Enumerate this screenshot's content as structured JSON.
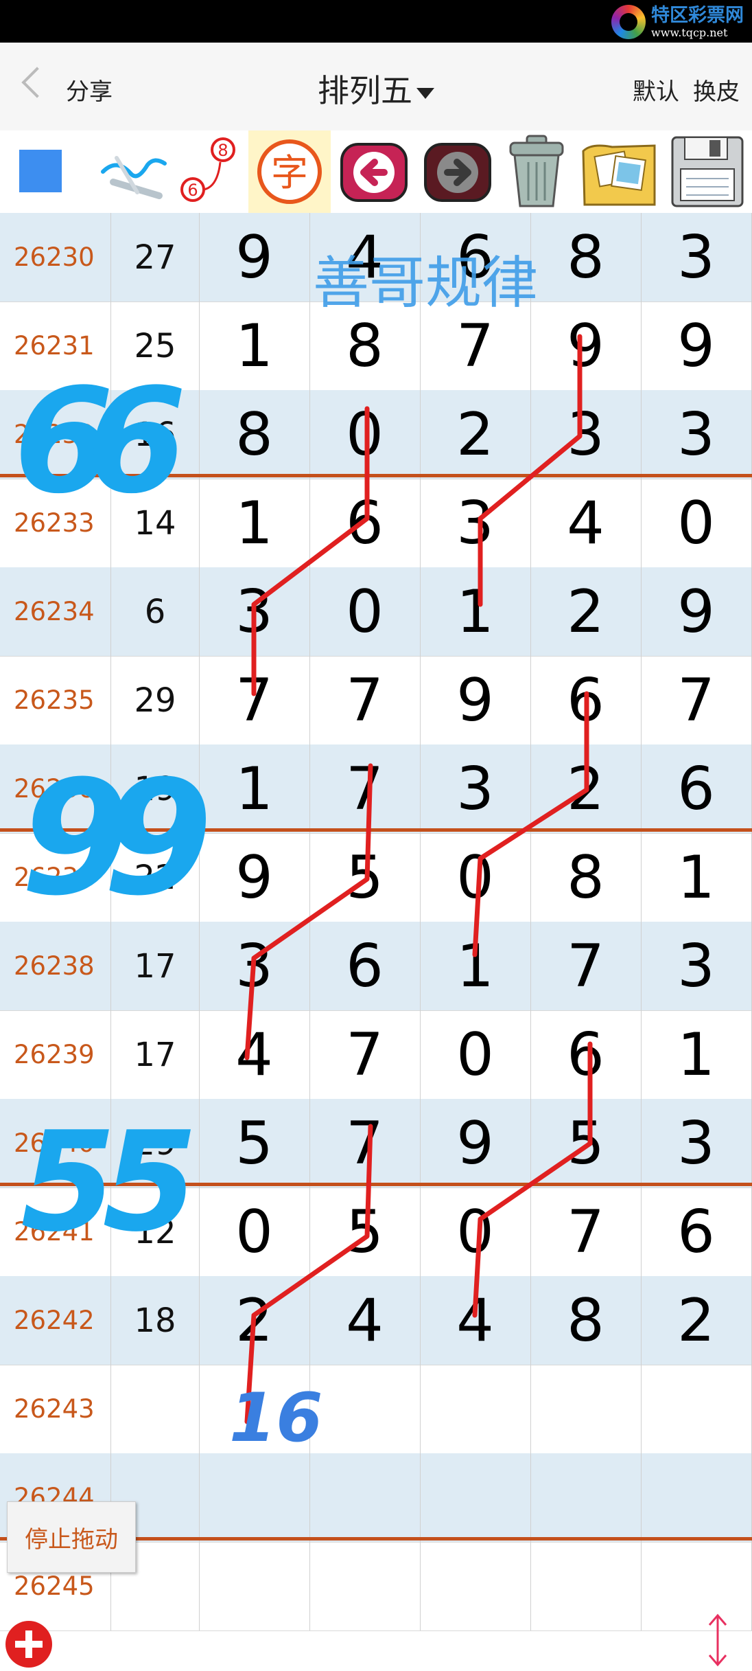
{
  "status_bar": {
    "brand_name": "特区彩票网",
    "brand_url": "www.tqcp.net"
  },
  "nav": {
    "share": "分享",
    "title": "排列五",
    "default": "默认",
    "skin": "换皮"
  },
  "toolbar": {
    "badge_top": "8",
    "badge_bottom": "6",
    "zi": "字"
  },
  "watermark": "善哥规律",
  "rows": [
    {
      "id": "26230",
      "sum": "27",
      "d": [
        "9",
        "4",
        "6",
        "8",
        "3"
      ]
    },
    {
      "id": "26231",
      "sum": "25",
      "d": [
        "1",
        "8",
        "7",
        "9",
        "9"
      ]
    },
    {
      "id": "26232",
      "sum": "16",
      "d": [
        "8",
        "0",
        "2",
        "3",
        "3"
      ]
    },
    {
      "id": "26233",
      "sum": "14",
      "d": [
        "1",
        "6",
        "3",
        "4",
        "0"
      ]
    },
    {
      "id": "26234",
      "sum": "6",
      "d": [
        "3",
        "0",
        "1",
        "2",
        "9"
      ]
    },
    {
      "id": "26235",
      "sum": "29",
      "d": [
        "7",
        "7",
        "9",
        "6",
        "7"
      ]
    },
    {
      "id": "26236",
      "sum": "19",
      "d": [
        "1",
        "7",
        "3",
        "2",
        "6"
      ]
    },
    {
      "id": "26237",
      "sum": "22",
      "d": [
        "9",
        "5",
        "0",
        "8",
        "1"
      ]
    },
    {
      "id": "26238",
      "sum": "17",
      "d": [
        "3",
        "6",
        "1",
        "7",
        "3"
      ]
    },
    {
      "id": "26239",
      "sum": "17",
      "d": [
        "4",
        "7",
        "0",
        "6",
        "1"
      ]
    },
    {
      "id": "26240",
      "sum": "29",
      "d": [
        "5",
        "7",
        "9",
        "5",
        "3"
      ]
    },
    {
      "id": "26241",
      "sum": "12",
      "d": [
        "0",
        "5",
        "0",
        "7",
        "6"
      ]
    },
    {
      "id": "26242",
      "sum": "18",
      "d": [
        "2",
        "4",
        "4",
        "8",
        "2"
      ]
    },
    {
      "id": "26243",
      "sum": "",
      "d": [
        "",
        "",
        "",
        "",
        ""
      ]
    },
    {
      "id": "26244",
      "sum": "",
      "d": [
        "",
        "",
        "",
        "",
        ""
      ]
    },
    {
      "id": "26245",
      "sum": "",
      "d": [
        "",
        "",
        "",
        "",
        ""
      ]
    }
  ],
  "annotations": {
    "marks": [
      "66",
      "99",
      "55"
    ],
    "prediction": "16"
  },
  "colors": {
    "blue_mark": "#1aa7ee",
    "red_line": "#e02020",
    "row_alt": "#deebf4",
    "id_text": "#c8581b"
  },
  "stop_drag": "停止拖动"
}
